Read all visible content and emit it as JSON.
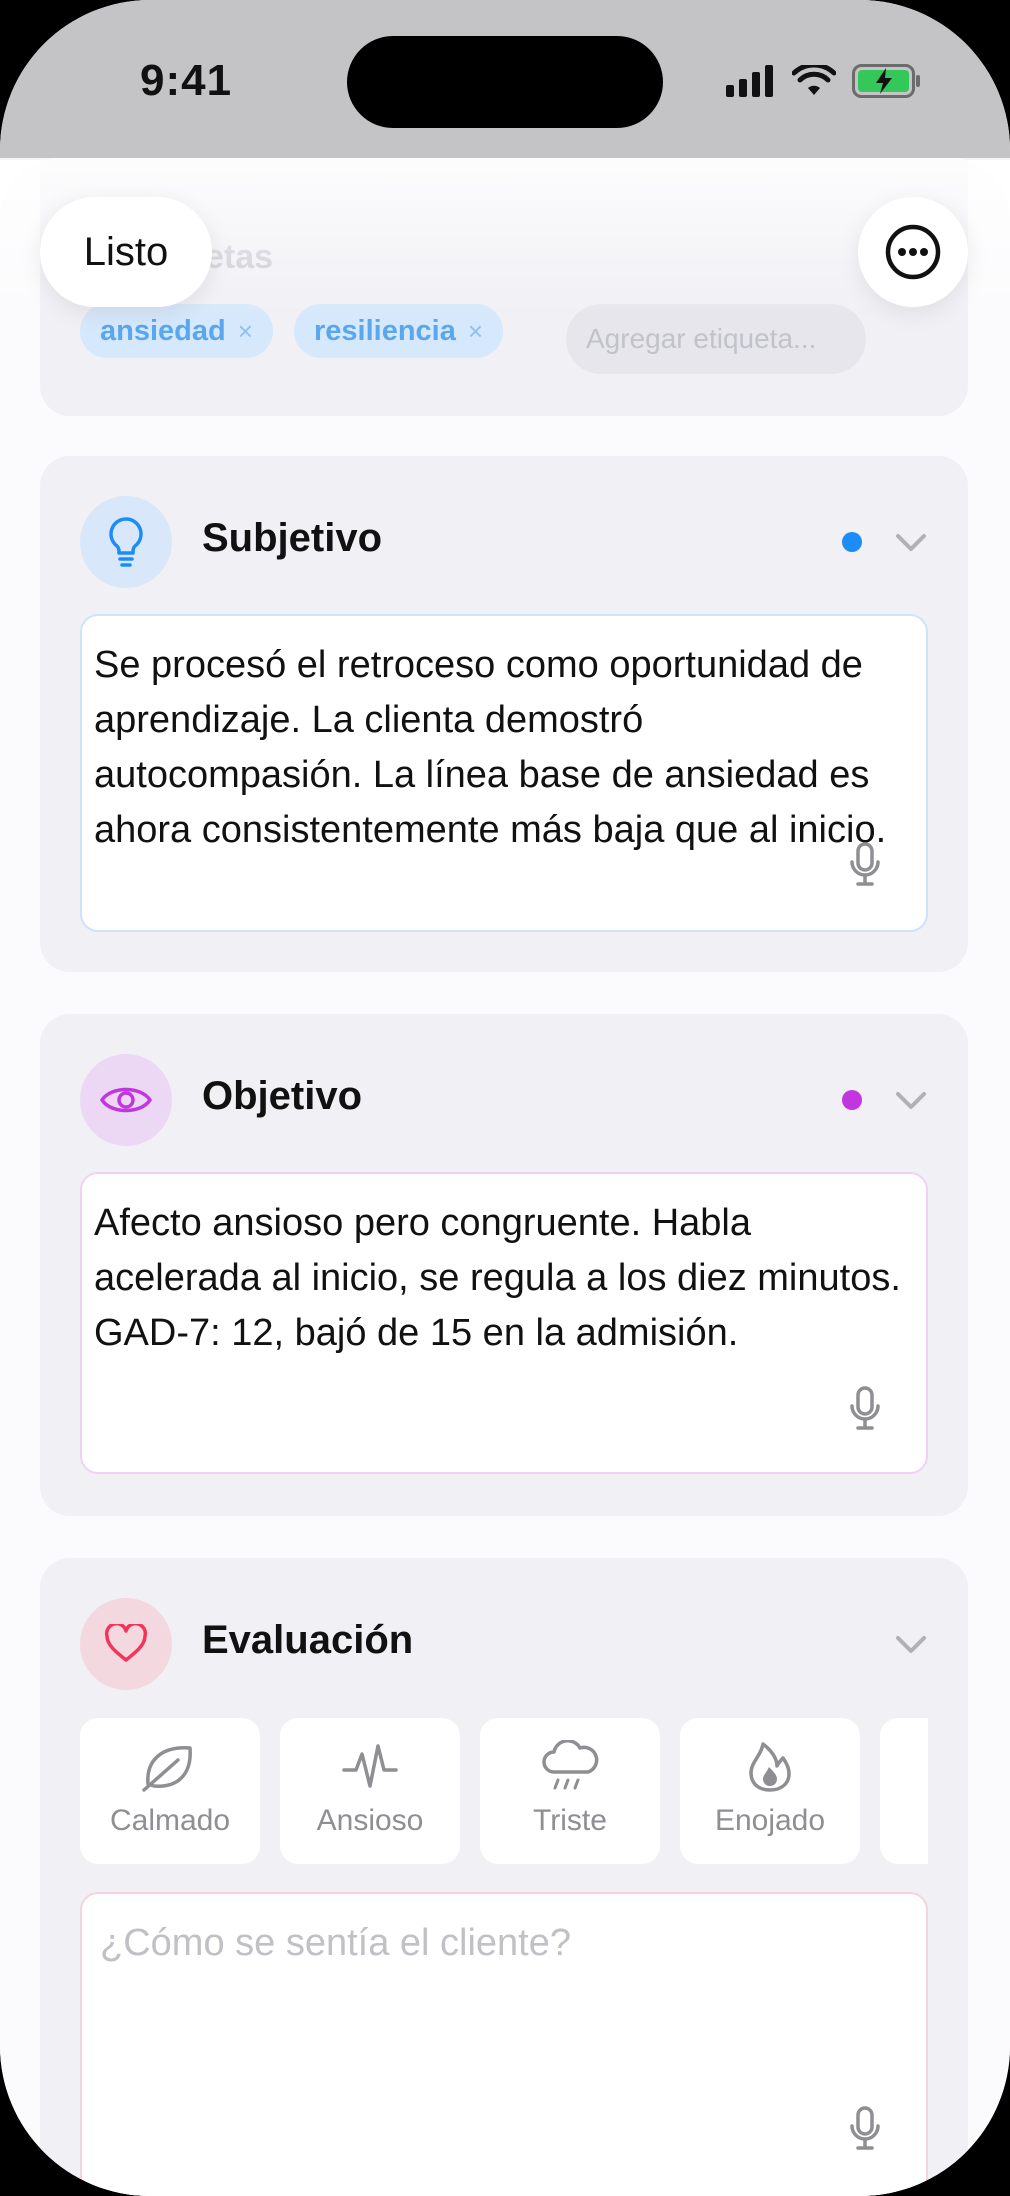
{
  "status": {
    "time": "9:41"
  },
  "toolbar": {
    "done_label": "Listo"
  },
  "tags": {
    "title": "Etiquetas",
    "items": [
      "ansiedad",
      "resiliencia"
    ],
    "remove_glyph": "×",
    "add_placeholder": "Agregar etiqueta..."
  },
  "sections": {
    "subjective": {
      "title": "Subjetivo",
      "text": "Se procesó el retroceso como oportunidad de aprendizaje. La clienta demostró autocompasión. La línea base de ansiedad es ahora consistentemente más baja que al inicio.",
      "accent": "#1d8cf8",
      "icon": "lightbulb-icon"
    },
    "objective": {
      "title": "Objetivo",
      "text": "Afecto ansioso pero congruente. Habla acelerada al inicio, se regula a los diez minutos. GAD-7: 12, bajó de 15 en la admisión.",
      "accent": "#c236e0",
      "icon": "eye-icon"
    },
    "assessment": {
      "title": "Evaluación",
      "accent": "#f0365b",
      "icon": "heart-icon",
      "moods": [
        {
          "label": "Calmado",
          "icon": "leaf-icon"
        },
        {
          "label": "Ansioso",
          "icon": "pulse-icon"
        },
        {
          "label": "Triste",
          "icon": "rain-cloud-icon"
        },
        {
          "label": "Enojado",
          "icon": "flame-icon"
        }
      ],
      "placeholder": "¿Cómo se sentía el cliente?"
    }
  }
}
